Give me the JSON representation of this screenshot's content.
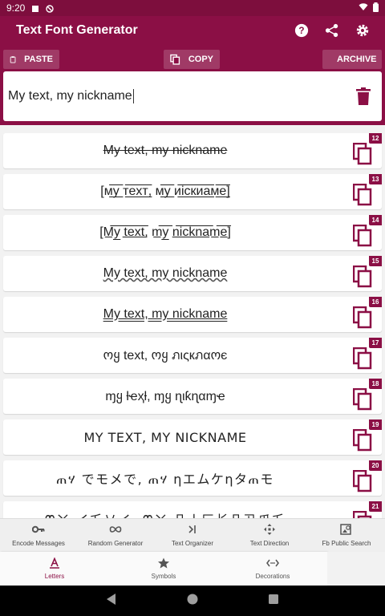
{
  "status_bar": {
    "time": "9:20"
  },
  "app_bar": {
    "title": "Text Font Generator",
    "icons": [
      "help-icon",
      "share-icon",
      "settings-icon"
    ]
  },
  "toolbar": {
    "paste_label": "PASTE",
    "copy_label": "COPY",
    "archive_label": "ARCHIVE"
  },
  "input": {
    "value": "My text, my nickname"
  },
  "styles": [
    {
      "num": "12",
      "text": "My text, my nickname"
    },
    {
      "num": "13",
      "text": "[м̲̅у̲̅ т̲̅е̲̅х̲̅т̲̅, м̲̅у̲̅ и̲̅і̲̅с̲̅к̲̅и̲̅а̲̅м̲̅е̲̅]"
    },
    {
      "num": "14",
      "text": "[M̲̅y̲̅ t̲̅e̲̅x̲̅t̲̅, m̲̅y̲̅ n̲̅i̲̅c̲̅k̲̅n̲̅a̲̅m̲̅e̲̅]"
    },
    {
      "num": "15",
      "text": "My text, my nickname"
    },
    {
      "num": "16",
      "text": "My text, my nickname"
    },
    {
      "num": "17",
      "text": "ოყ tеxt, ოყ ภιςкภαოє"
    },
    {
      "num": "18",
      "text": "ɱყ ƚҽҳƚ, ɱყ ɳιƙɳαɱҽ"
    },
    {
      "num": "19",
      "text": "MY TEXT, MY NICKNAME"
    },
    {
      "num": "20",
      "text": "ጠሃ でモメで, ጠሃ ηエムケηタጠモ"
    },
    {
      "num": "21",
      "text": "ᙏㄚ イ乇乂イ, ᙏㄚ 几丨匚长几卂爪乇"
    }
  ],
  "tools_nav": [
    {
      "label": "Encode Messages",
      "icon": "key-icon"
    },
    {
      "label": "Random Generator",
      "icon": "infinity-icon"
    },
    {
      "label": "Text Organizer",
      "icon": "cursor-icon"
    },
    {
      "label": "Text Direction",
      "icon": "arrows-icon"
    },
    {
      "label": "Fb Public Search",
      "icon": "image-search-icon"
    }
  ],
  "bottom_nav": [
    {
      "label": "Letters",
      "icon": "letter-a-icon",
      "active": true
    },
    {
      "label": "Symbols",
      "icon": "star-icon",
      "active": false
    },
    {
      "label": "Decorations",
      "icon": "code-dots-icon",
      "active": false
    }
  ],
  "colors": {
    "primary": "#8b0f45",
    "status": "#7d0e3d",
    "text": "#222222",
    "background": "#f2f2f2"
  }
}
